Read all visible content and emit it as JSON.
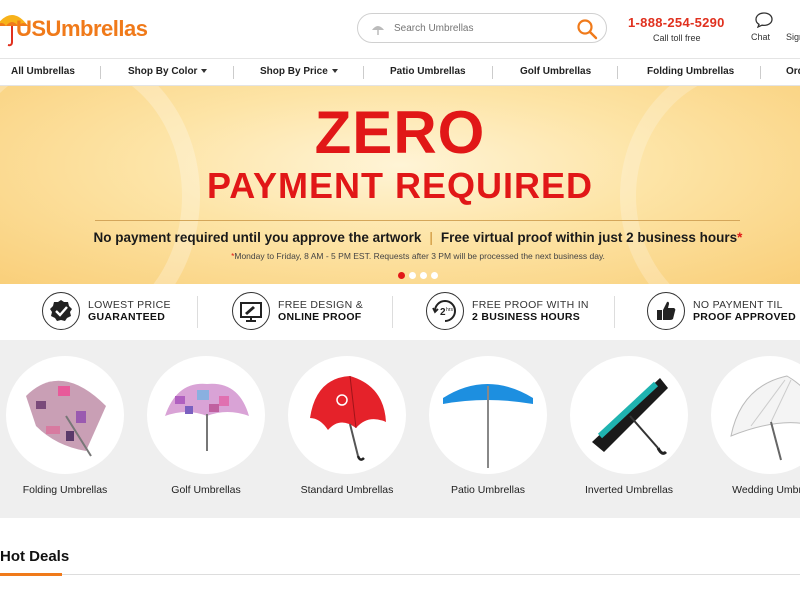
{
  "header": {
    "logo_text": "USUmbrellas",
    "search_placeholder": "Search Umbrellas",
    "phone": "1-888-254-5290",
    "phone_caption": "Call toll free",
    "chat_label": "Chat",
    "sign_label": "Sign"
  },
  "nav": {
    "items": [
      {
        "label": "All Umbrellas"
      },
      {
        "label": "Shop By Color"
      },
      {
        "label": "Shop By Price"
      },
      {
        "label": "Patio Umbrellas"
      },
      {
        "label": "Golf Umbrellas"
      },
      {
        "label": "Folding Umbrellas"
      },
      {
        "label": "Ord"
      }
    ]
  },
  "banner": {
    "title_line1": "ZERO",
    "title_line2": "PAYMENT REQUIRED",
    "subline_left": "No payment required until you approve the artwork",
    "subline_sep": "|",
    "subline_right": "Free virtual proof within just 2 business hours",
    "subline_star": "*",
    "note_star": "*",
    "note": "Monday to Friday, 8 AM - 5 PM EST. Requests after 3 PM will be processed the next business day.",
    "slide_count": 4,
    "active_slide": 1
  },
  "features": [
    {
      "line1": "LOWEST PRICE",
      "line2": "GUARANTEED",
      "icon": "badge-check-icon"
    },
    {
      "line1": "FREE DESIGN &",
      "line2": "ONLINE PROOF",
      "icon": "monitor-design-icon"
    },
    {
      "line1": "FREE PROOF WITH IN",
      "line2": "2 BUSINESS HOURS",
      "icon": "two-hours-icon"
    },
    {
      "line1": "NO PAYMENT TIL",
      "line2": "PROOF APPROVED",
      "icon": "thumbs-up-icon"
    }
  ],
  "categories": [
    {
      "label": "Folding Umbrellas"
    },
    {
      "label": "Golf Umbrellas"
    },
    {
      "label": "Standard Umbrellas"
    },
    {
      "label": "Patio Umbrellas"
    },
    {
      "label": "Inverted Umbrellas"
    },
    {
      "label": "Wedding Umbre"
    }
  ],
  "deals": {
    "title": "Hot Deals"
  },
  "colors": {
    "brand_orange": "#f07a1a",
    "phone_red": "#e0301e",
    "banner_red": "#e11717",
    "patio_blue": "#1d8fe0",
    "inverted_teal": "#1fb3b0"
  }
}
